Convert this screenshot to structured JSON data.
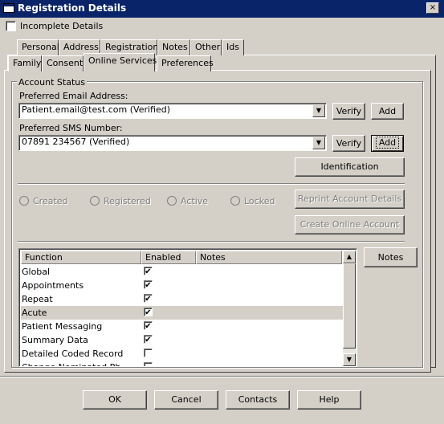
{
  "window": {
    "title": "Registration Details",
    "close_label": "×"
  },
  "incomplete": {
    "label": "Incomplete Details",
    "checked": false
  },
  "tabs_row1": [
    "Personal",
    "Address",
    "Registration",
    "Notes",
    "Other",
    "Ids"
  ],
  "tabs_row2": [
    "Family",
    "Consent",
    "Online Services",
    "Preferences"
  ],
  "account": {
    "group_label": "Account Status",
    "email_label": "Preferred Email Address:",
    "email_value": "Patient.email@test.com (Verified)",
    "sms_label": "Preferred SMS Number:",
    "sms_value": "07891 234567 (Verified)",
    "verify_label": "Verify",
    "add_label": "Add",
    "identification_label": "Identification",
    "radios": [
      "Created",
      "Registered",
      "Active",
      "Locked"
    ],
    "reprint_label": "Reprint Account Details",
    "create_online_label": "Create Online Account",
    "notes_button_label": "Notes"
  },
  "function_table": {
    "headers": [
      "Function",
      "Enabled",
      "Notes"
    ],
    "rows": [
      {
        "function": "Global",
        "enabled": true
      },
      {
        "function": "Appointments",
        "enabled": true
      },
      {
        "function": "Repeat",
        "enabled": true
      },
      {
        "function": "Acute",
        "enabled": true
      },
      {
        "function": "Patient Messaging",
        "enabled": true
      },
      {
        "function": "Summary Data",
        "enabled": true
      },
      {
        "function": "Detailed Coded Record",
        "enabled": false
      },
      {
        "function": "Change Nominated Ph",
        "enabled": false
      }
    ]
  },
  "footer": {
    "ok": "OK",
    "cancel": "Cancel",
    "contacts": "Contacts",
    "help": "Help"
  }
}
